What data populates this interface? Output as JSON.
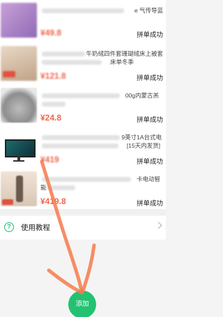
{
  "items": [
    {
      "title_tail": "e 气传导蓝",
      "price": "¥49.8",
      "price_blurred": true,
      "status": "拼单成功"
    },
    {
      "title_tail_1": "牛奶绒四件套珊瑚绒床上被套",
      "title_tail_2": "床单冬季",
      "price": "¥121.8",
      "price_blurred": true,
      "status": "拼单成功"
    },
    {
      "title_tail": "00g内蒙古羔",
      "price": "¥24.8",
      "price_blurred": false,
      "status": "拼单成功"
    },
    {
      "title_tail_1": "9英寸1A台式电",
      "title_tail_2": "[15天内发货]",
      "price": "¥419",
      "price_blurred": true,
      "status": "拼单成功"
    },
    {
      "title_tail_1": "卡电动智",
      "title_tail_2": "能",
      "price": "¥419.8",
      "price_blurred": false,
      "status": "拼单成功"
    }
  ],
  "tutorial": {
    "label": "使用教程"
  },
  "add_button": {
    "label": "添加"
  },
  "colors": {
    "price": "#f2664b",
    "accent_green": "#22c271",
    "annotation_orange": "#f47a4b"
  }
}
